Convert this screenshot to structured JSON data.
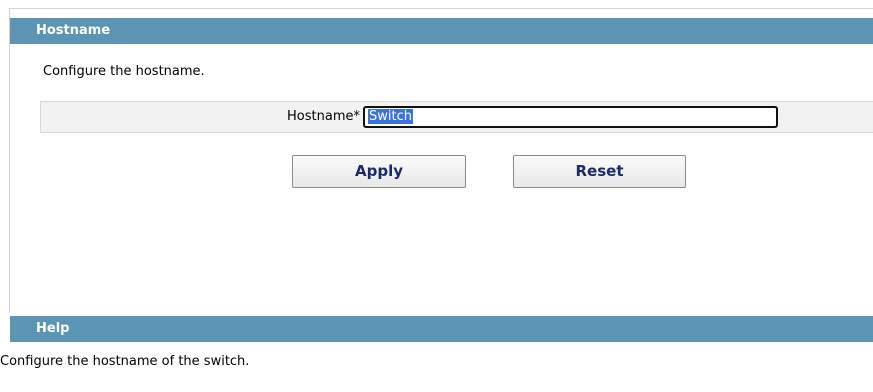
{
  "hostname_section": {
    "title": "Hostname",
    "description": "Configure the hostname.",
    "field_label": "Hostname*",
    "field_value": "Switch",
    "apply_label": "Apply",
    "reset_label": "Reset"
  },
  "help_section": {
    "title": "Help",
    "text": "Configure the hostname of the switch."
  },
  "colors": {
    "header_bar": "#5b95b3",
    "form_row_bg": "#f2f2f2",
    "button_text": "#1a2a6b",
    "selection": "#3a73d9"
  }
}
